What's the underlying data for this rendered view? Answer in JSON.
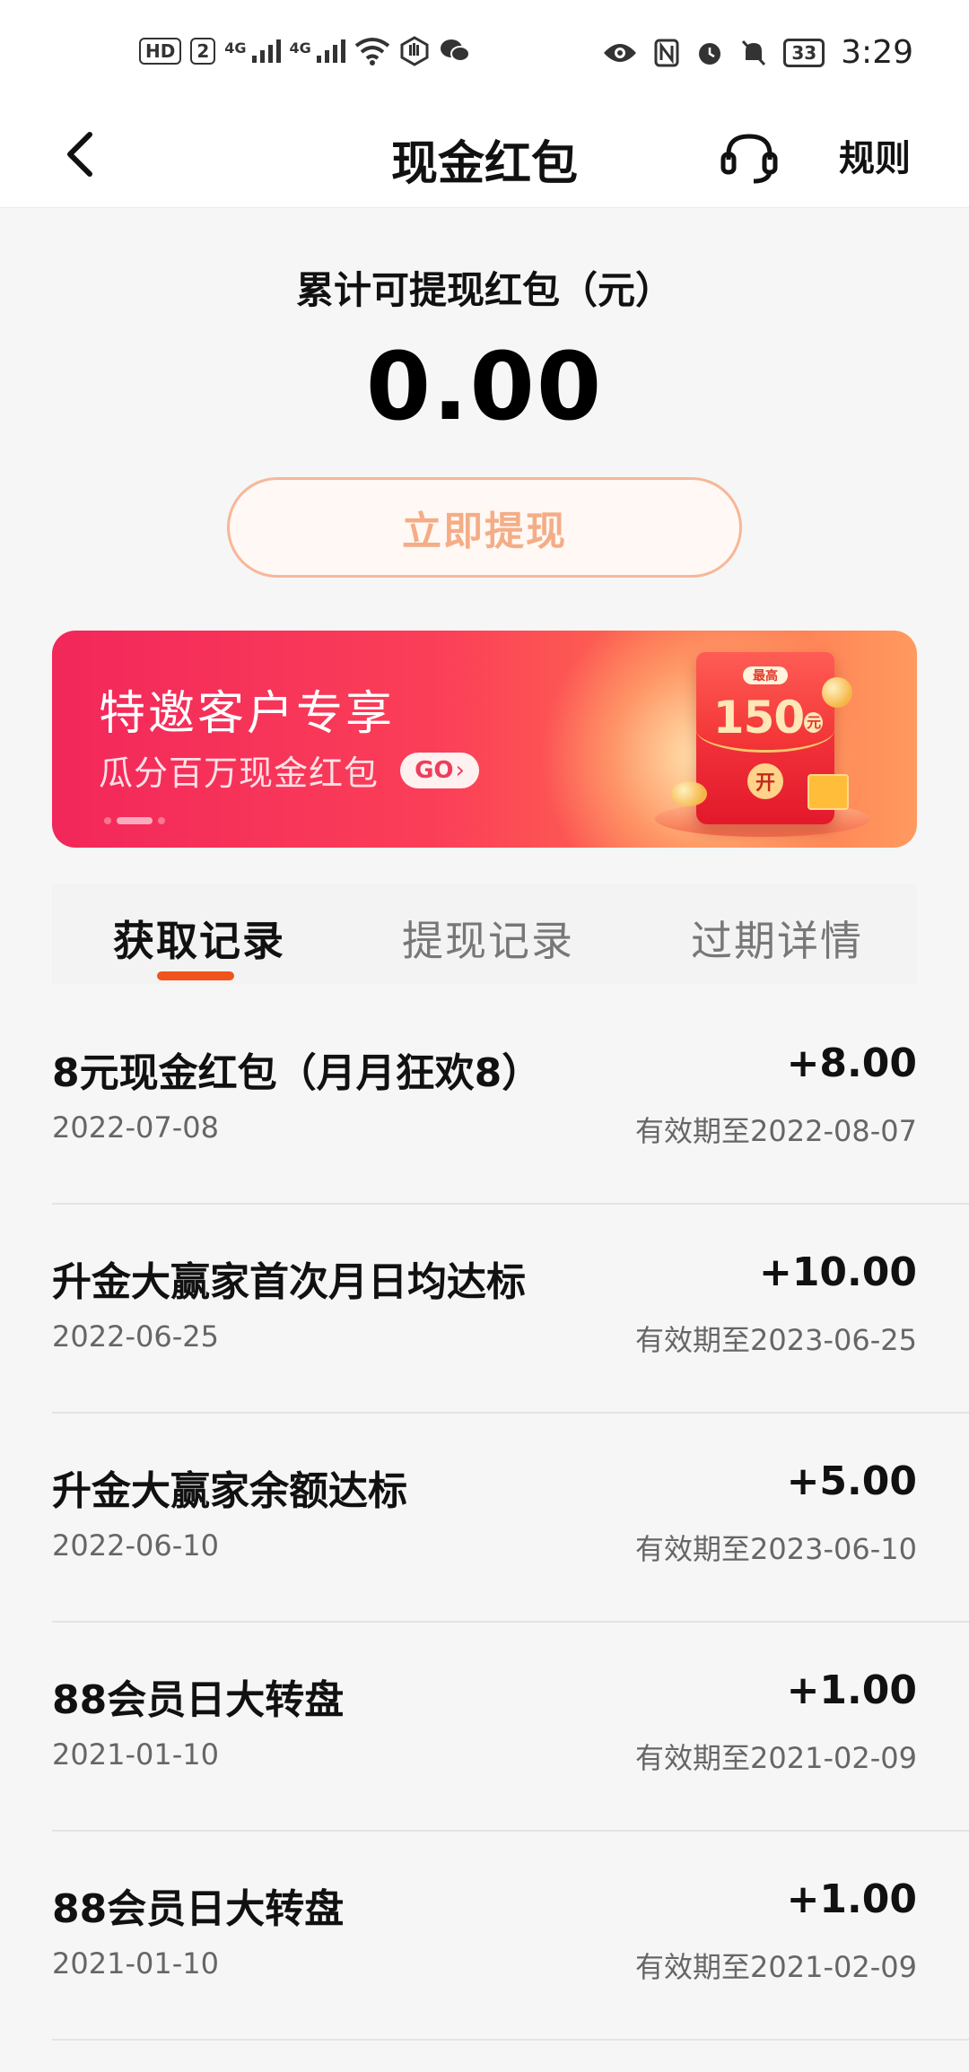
{
  "status_bar": {
    "hd_badge": "HD",
    "sim_number": "2",
    "network_1": "4G",
    "network_2": "4G",
    "battery_level": "33",
    "time": "3:29"
  },
  "header": {
    "title": "现金红包",
    "rules_label": "规则"
  },
  "balance": {
    "label": "累计可提现红包（元）",
    "value": "0.00",
    "withdraw_label": "立即提现"
  },
  "banner": {
    "title": "特邀客户专享",
    "subtitle": "瓜分百万现金红包",
    "go_label": "GO",
    "envelope_max_label": "最高",
    "envelope_amount": "150",
    "envelope_unit": "元",
    "envelope_open_label": "开"
  },
  "tabs": [
    {
      "label": "获取记录",
      "active": true
    },
    {
      "label": "提现记录",
      "active": false
    },
    {
      "label": "过期详情",
      "active": false
    }
  ],
  "records": [
    {
      "title": "8元现金红包（月月狂欢8）",
      "date": "2022-07-08",
      "amount": "+8.00",
      "expiry": "有效期至2022-08-07"
    },
    {
      "title": "升金大赢家首次月日均达标",
      "date": "2022-06-25",
      "amount": "+10.00",
      "expiry": "有效期至2023-06-25"
    },
    {
      "title": "升金大赢家余额达标",
      "date": "2022-06-10",
      "amount": "+5.00",
      "expiry": "有效期至2023-06-10"
    },
    {
      "title": "88会员日大转盘",
      "date": "2021-01-10",
      "amount": "+1.00",
      "expiry": "有效期至2021-02-09"
    },
    {
      "title": "88会员日大转盘",
      "date": "2021-01-10",
      "amount": "+1.00",
      "expiry": "有效期至2021-02-09"
    }
  ],
  "colors": {
    "accent": "#f0531c",
    "withdraw_border": "#f5b898",
    "banner_start": "#f2275a",
    "banner_end": "#ff9a5f"
  },
  "icons": {
    "back": "chevron-left-icon",
    "support": "headset-icon"
  }
}
